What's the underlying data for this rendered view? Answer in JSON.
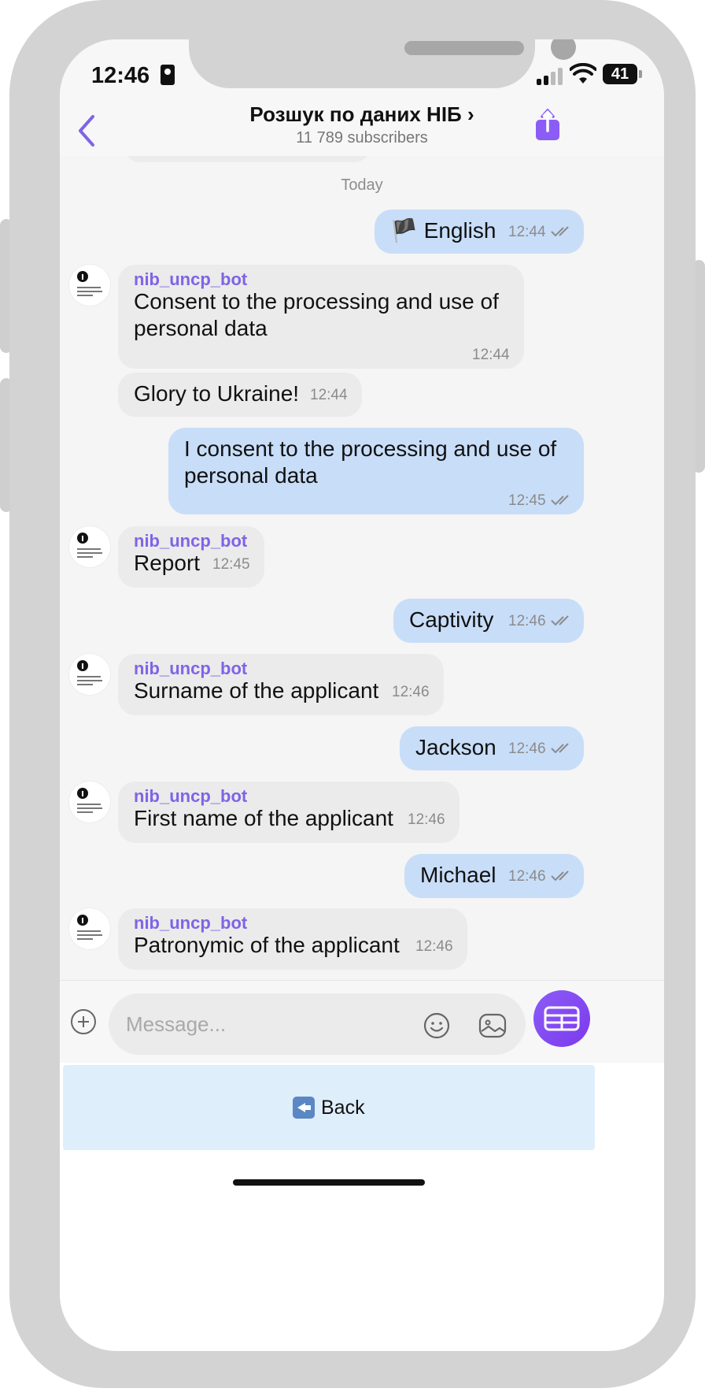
{
  "status_bar": {
    "time": "12:46",
    "battery": "41"
  },
  "header": {
    "title": "Розшук по даних НІБ ›",
    "subtitle": "11 789 subscribers"
  },
  "chat": {
    "date_separator": "Today",
    "messages": [
      {
        "direction": "out",
        "text": "🏴 English",
        "time": "12:44"
      },
      {
        "direction": "in",
        "sender": "nib_uncp_bot",
        "text_lines": [
          "Consent to the processing and use of",
          "personal data"
        ],
        "time": "12:44"
      },
      {
        "direction": "in",
        "text": "Glory to Ukraine!",
        "time": "12:44"
      },
      {
        "direction": "out",
        "text_lines": [
          "I consent to the processing and use of",
          "personal data"
        ],
        "time": "12:45"
      },
      {
        "direction": "in",
        "sender": "nib_uncp_bot",
        "text": "Report",
        "time": "12:45"
      },
      {
        "direction": "out",
        "text": "Captivity",
        "time": "12:46"
      },
      {
        "direction": "in",
        "sender": "nib_uncp_bot",
        "text": "Surname of the applicant",
        "time": "12:46"
      },
      {
        "direction": "out",
        "text": "Jackson",
        "time": "12:46"
      },
      {
        "direction": "in",
        "sender": "nib_uncp_bot",
        "text": "First name of the applicant",
        "time": "12:46"
      },
      {
        "direction": "out",
        "text": "Michael",
        "time": "12:46"
      },
      {
        "direction": "in",
        "sender": "nib_uncp_bot",
        "text": "Patronymic of the applicant",
        "time": "12:46"
      }
    ]
  },
  "input": {
    "placeholder": "Message..."
  },
  "keyboard": {
    "back_label": "Back"
  },
  "colors": {
    "accent": "#7f64e6",
    "outgoing_bubble": "#c8ddf8",
    "incoming_bubble": "#ebebeb"
  },
  "icons": [
    "back-chevron-icon",
    "share-icon",
    "plus-icon",
    "emoji-icon",
    "sticker-icon",
    "keyboard-grid-icon",
    "back-arrow-emoji-icon"
  ]
}
